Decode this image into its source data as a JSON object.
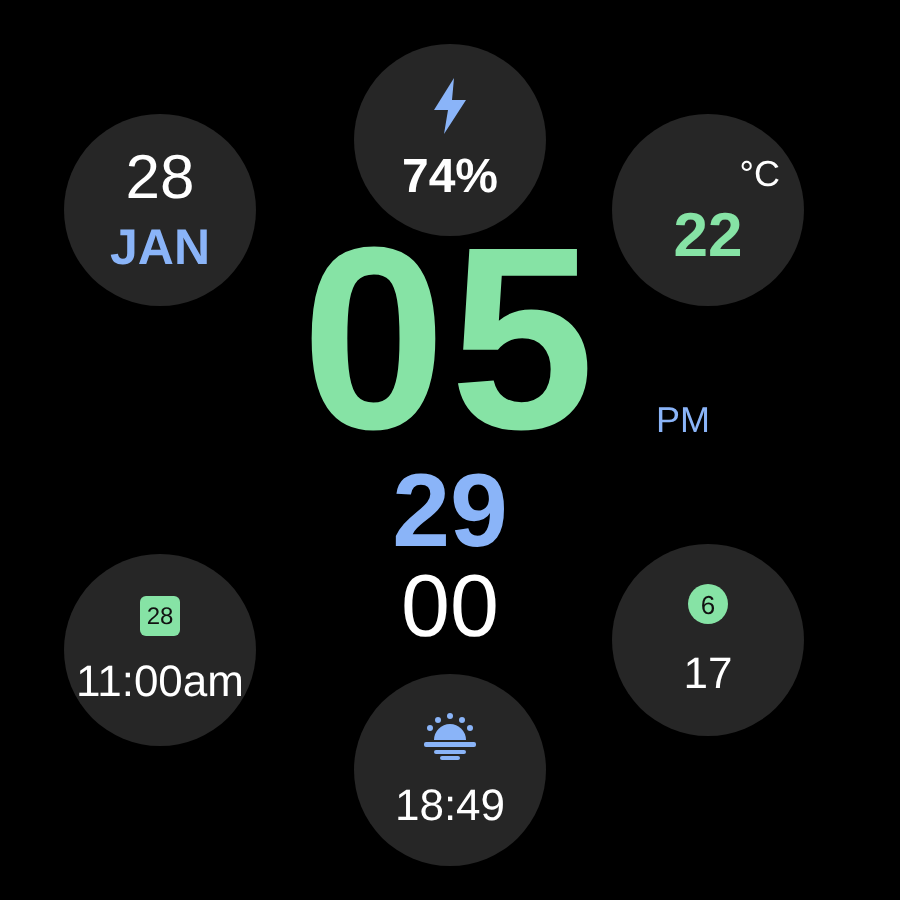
{
  "time": {
    "hours": "05",
    "meridiem": "PM",
    "minutes": "29",
    "seconds": "00"
  },
  "complications": [
    {
      "kind": "date",
      "day": "28",
      "month": "JAN"
    },
    {
      "kind": "battery",
      "value": "74%"
    },
    {
      "kind": "temperature",
      "unit": "°C",
      "value": "22"
    },
    {
      "kind": "calendar",
      "icon_text": "28",
      "value": "11:00am"
    },
    {
      "kind": "badge",
      "badge": "6",
      "value": "17"
    },
    {
      "kind": "sunset",
      "value": "18:49"
    }
  ]
}
